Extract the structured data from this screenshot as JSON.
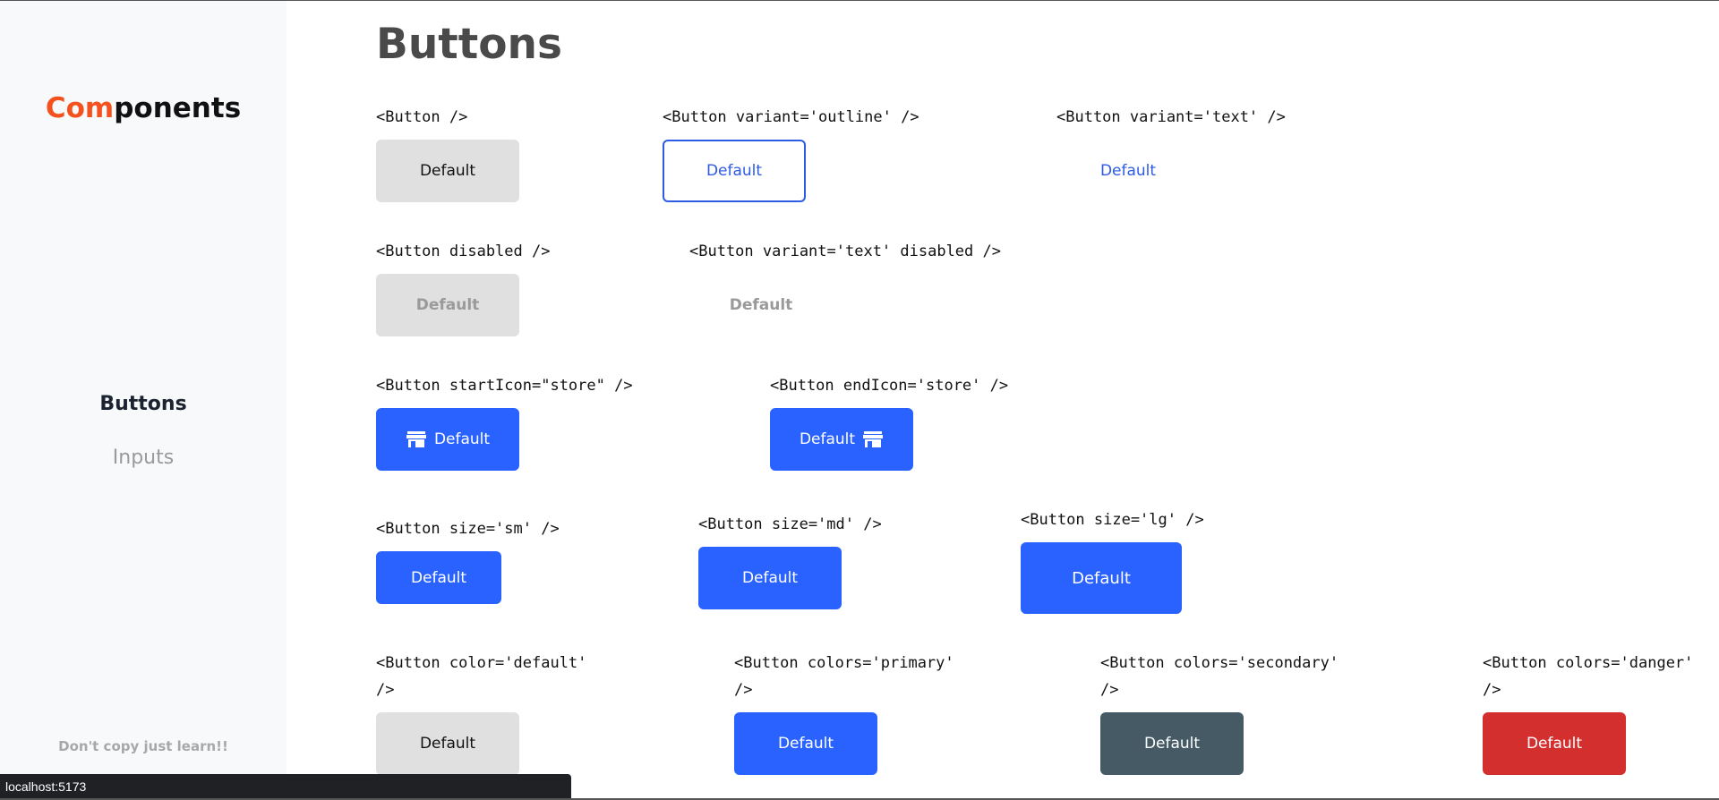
{
  "sidebar": {
    "logo_accent": "Com",
    "logo_rest": "ponents",
    "nav": [
      {
        "label": "Buttons",
        "active": true
      },
      {
        "label": "Inputs",
        "active": false
      }
    ],
    "footnote": "Don't copy just learn!!"
  },
  "main": {
    "title": "Buttons",
    "examples": {
      "basic": {
        "code": "<Button />",
        "label": "Default"
      },
      "outline": {
        "code": "<Button variant='outline' />",
        "label": "Default"
      },
      "text": {
        "code": "<Button variant='text' />",
        "label": "Default"
      },
      "disabled": {
        "code": "<Button disabled />",
        "label": "Default"
      },
      "text_disabled": {
        "code": "<Button variant='text' disabled />",
        "label": "Default"
      },
      "start_icon": {
        "code": "<Button startIcon=\"store\" />",
        "label": "Default",
        "icon": "store-icon"
      },
      "end_icon": {
        "code": "<Button endIcon='store' />",
        "label": "Default",
        "icon": "store-icon"
      },
      "size_sm": {
        "code": "<Button size='sm' />",
        "label": "Default"
      },
      "size_md": {
        "code": "<Button size='md' />",
        "label": "Default"
      },
      "size_lg": {
        "code": "<Button size='lg' />",
        "label": "Default"
      },
      "color_default": {
        "code": "<Button color='default'\n/>",
        "label": "Default"
      },
      "color_primary": {
        "code": "<Button colors='primary'\n/>",
        "label": "Default"
      },
      "color_secondary": {
        "code": "<Button colors='secondary'\n/>",
        "label": "Default"
      },
      "color_danger": {
        "code": "<Button colors='danger'\n/>",
        "label": "Default"
      }
    }
  },
  "statusbar": {
    "url": "localhost:5173"
  },
  "colors": {
    "accent": "#f4511e",
    "primary": "#2962ff",
    "secondary": "#455a64",
    "danger": "#d32f2f",
    "default": "#e0e0e0"
  }
}
